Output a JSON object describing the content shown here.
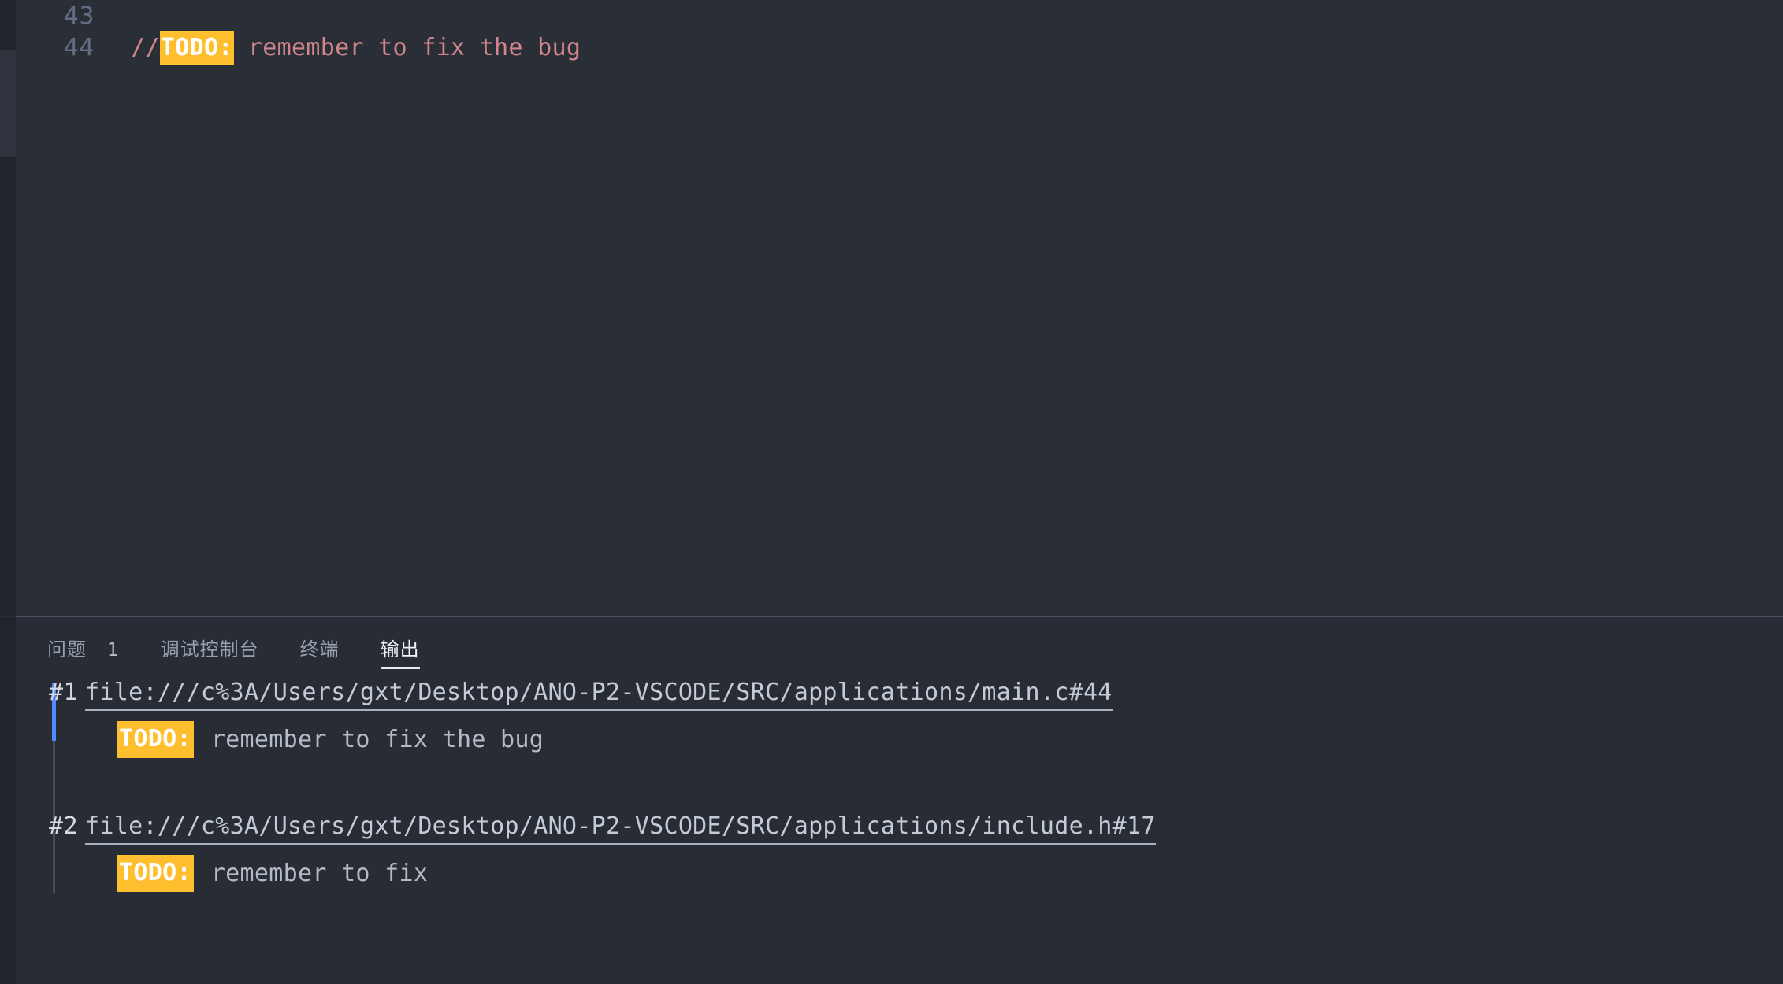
{
  "theme": {
    "editor_bg": "#2a2e37",
    "panel_bg": "#282c34",
    "strip_bg": "#21252b",
    "accent_blue": "#528bff",
    "todo_highlight": "#ffbe2e",
    "comment_color": "#d1868c",
    "linenumber_color": "#636d83"
  },
  "editor": {
    "lines": [
      {
        "number": "43",
        "comment_prefix": "",
        "todo": "",
        "text": ""
      },
      {
        "number": "44",
        "comment_prefix": "//",
        "todo": "TODO:",
        "text": " remember to fix the bug"
      }
    ]
  },
  "panel": {
    "tabs": [
      {
        "label": "问题",
        "count": "1",
        "active": false
      },
      {
        "label": "调试控制台",
        "count": "",
        "active": false
      },
      {
        "label": "终端",
        "count": "",
        "active": false
      },
      {
        "label": "输出",
        "count": "",
        "active": true
      }
    ],
    "output": {
      "entries": [
        {
          "index": "#1",
          "link": "file:///c%3A/Users/gxt/Desktop/ANO-P2-VSCODE/SRC/applications/main.c#44",
          "tag": "TODO:",
          "message": "remember to fix the bug"
        },
        {
          "index": "#2",
          "link": "file:///c%3A/Users/gxt/Desktop/ANO-P2-VSCODE/SRC/applications/include.h#17",
          "tag": "TODO:",
          "message": "remember to fix"
        }
      ]
    }
  }
}
